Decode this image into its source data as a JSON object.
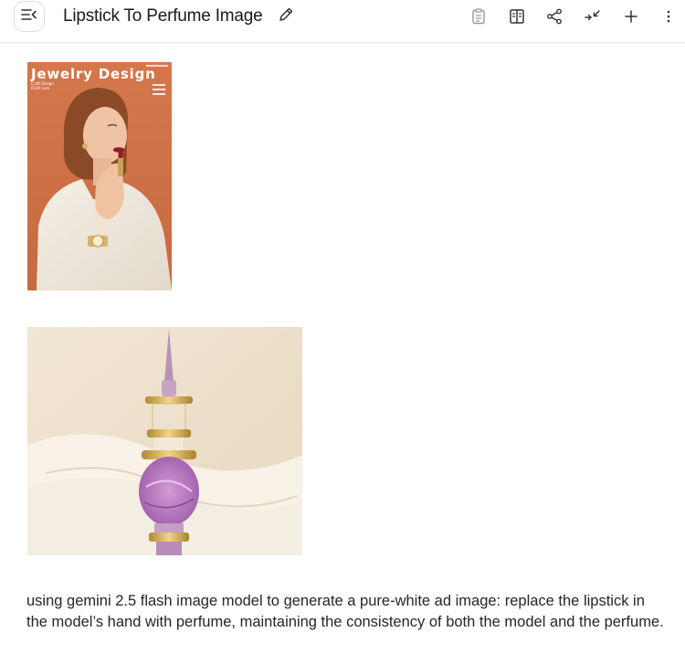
{
  "header": {
    "title": "Lipstick To Perfume Image",
    "icons": {
      "menu": "sidebar-collapse-icon",
      "edit": "pencil-icon",
      "notes": "clipboard-icon",
      "compare": "book-open-icon",
      "share": "share-icon",
      "collapse": "collapse-arrows-icon",
      "add": "plus-icon",
      "more": "more-vertical-icon"
    }
  },
  "images": {
    "first": {
      "magazine_title": "Jewelry Design",
      "subtitle_lines": [
        "Craft Design",
        "FLUX Lora"
      ]
    }
  },
  "prompt_text": "using gemini 2.5 flash image model  to generate a pure-white ad image: replace the lipstick in the model’s hand with perfume, maintaining the consistency of both the model and the perfume.",
  "colors": {
    "accent_orange": "#d97a4a",
    "text": "#262626"
  }
}
